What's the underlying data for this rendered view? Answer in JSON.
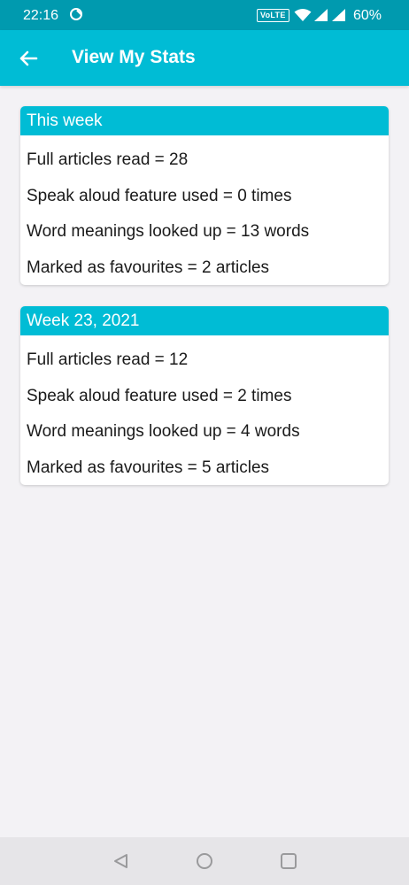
{
  "status_bar": {
    "time": "22:16",
    "volte": "VoLTE",
    "battery": "60%",
    "icons": [
      "app-notification-icon",
      "wifi-icon",
      "signal-icon",
      "signal-icon",
      "battery-text"
    ]
  },
  "app_bar": {
    "title": "View My Stats",
    "back_icon": "arrow-left-icon",
    "color": "#00bcd5"
  },
  "cards": [
    {
      "header": "This week",
      "stats": [
        "Full articles read = 28",
        "Speak aloud feature used = 0 times",
        "Word meanings looked up = 13 words",
        "Marked as favourites = 2 articles"
      ]
    },
    {
      "header": "Week 23, 2021",
      "stats": [
        "Full articles read = 12",
        "Speak aloud feature used = 2 times",
        "Word meanings looked up = 4 words",
        "Marked as favourites = 5 articles"
      ]
    }
  ],
  "nav_bar": {
    "icons": [
      "back-triangle-icon",
      "home-circle-icon",
      "recents-square-icon"
    ]
  }
}
